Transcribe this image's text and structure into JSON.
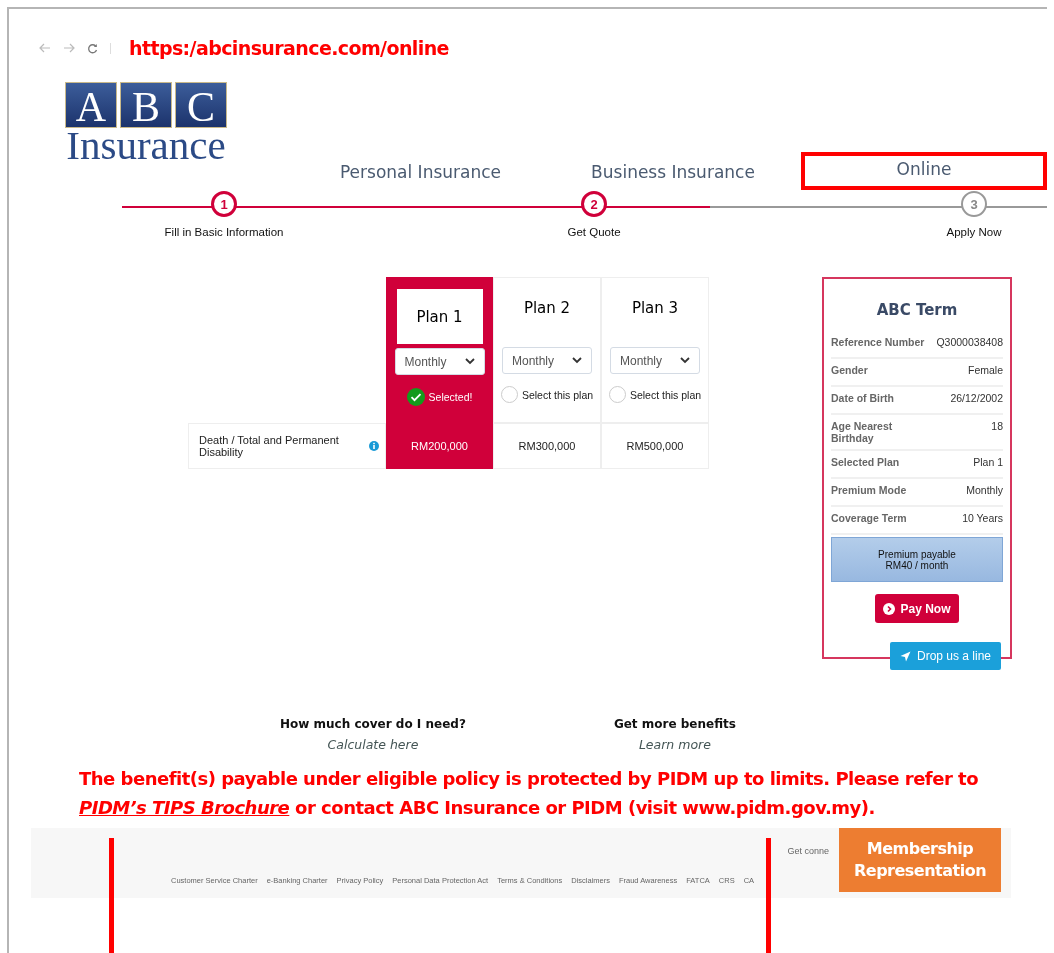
{
  "browser": {
    "url": "https:/abcinsurance.com/online"
  },
  "logo": {
    "letters": [
      "A",
      "B",
      "C"
    ],
    "word": "Insurance"
  },
  "nav": [
    {
      "label": "Personal Insurance",
      "selected": false
    },
    {
      "label": "Business Insurance",
      "selected": false
    },
    {
      "label": "Online",
      "selected": true
    }
  ],
  "steps": [
    {
      "number": "1",
      "label": "Fill in Basic Information",
      "done": true
    },
    {
      "number": "2",
      "label": "Get Quote",
      "done": true
    },
    {
      "number": "3",
      "label": "Apply Now",
      "done": false
    }
  ],
  "plans": [
    {
      "name": "Plan 1",
      "mode": "Monthly",
      "selected": true,
      "select_label": "Selected!",
      "amount": "RM200,000"
    },
    {
      "name": "Plan 2",
      "mode": "Monthly",
      "selected": false,
      "select_label": "Select this plan",
      "amount": "RM300,000"
    },
    {
      "name": "Plan 3",
      "mode": "Monthly",
      "selected": false,
      "select_label": "Select this plan",
      "amount": "RM500,000"
    }
  ],
  "benefit_row": {
    "label": "Death / Total and Permanent Disability"
  },
  "summary": {
    "title": "ABC Term",
    "rows": [
      {
        "label": "Reference Number",
        "value": "Q3000038408"
      },
      {
        "label": "Gender",
        "value": "Female"
      },
      {
        "label": "Date of Birth",
        "value": "26/12/2002"
      },
      {
        "label": "Age Nearest Birthday",
        "value": "18"
      },
      {
        "label": "Selected Plan",
        "value": "Plan 1"
      },
      {
        "label": "Premium Mode",
        "value": "Monthly"
      },
      {
        "label": "Coverage Term",
        "value": "10 Years"
      }
    ],
    "premium": [
      "Premium payable",
      "RM40 / month"
    ],
    "pay_button": "Pay Now",
    "contact_button": "Drop us a line"
  },
  "links": [
    {
      "heading": "How much cover do I need?",
      "link": "Calculate here"
    },
    {
      "heading": "Get more benefits",
      "link": "Learn more"
    }
  ],
  "notice": {
    "before": "The benefit(s) payable under eligible policy is protected by PIDM up to limits. Please refer to",
    "link": "PIDM’s TIPS Brochure",
    "after": "or contact ABC Insurance or PIDM (visit www.pidm.gov.my)."
  },
  "footer": {
    "connect": "Get conne",
    "links": [
      "Customer Service Charter",
      "e-Banking Charter",
      "Privacy Policy",
      "Personal Data Protection Act",
      "Terms & Conditions",
      "Disclaimers",
      "Fraud Awareness",
      "FATCA",
      "CRS",
      "CA"
    ],
    "badge": [
      "Membership",
      "Representation"
    ]
  }
}
